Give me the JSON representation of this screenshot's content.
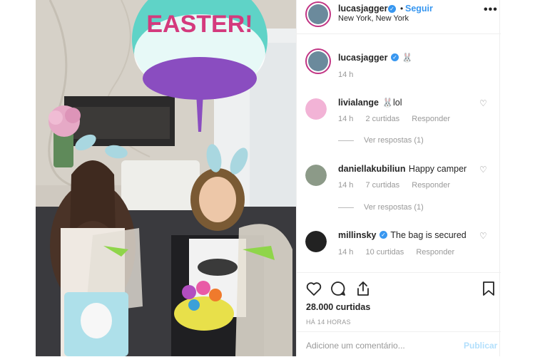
{
  "post": {
    "username": "lucasjagger",
    "follow_label": "Seguir",
    "separator": "•",
    "location": "New York, New York",
    "more_label": "•••",
    "balloon_text": "EASTER!"
  },
  "caption": {
    "username": "lucasjagger",
    "text": "🐰",
    "time": "14 h"
  },
  "comments": [
    {
      "username": "livialange",
      "text": "🐰lol",
      "time": "14 h",
      "likes": "2 curtidas",
      "reply_label": "Responder",
      "view_replies": "Ver respostas (1)"
    },
    {
      "username": "daniellakubiliun",
      "text": "Happy camper",
      "time": "14 h",
      "likes": "7 curtidas",
      "reply_label": "Responder",
      "view_replies": "Ver respostas (1)"
    },
    {
      "username": "millinsky",
      "text": "The bag is secured",
      "time": "14 h",
      "likes": "10 curtidas",
      "reply_label": "Responder"
    }
  ],
  "stats": {
    "likes": "28.000 curtidas",
    "time_ago": "HÁ 14 HORAS"
  },
  "composer": {
    "placeholder": "Adicione um comentário...",
    "publish_label": "Publicar"
  },
  "colors": {
    "link": "#3897f0",
    "muted": "#999999",
    "text": "#262626"
  },
  "icons": [
    "heart-icon",
    "comment-icon",
    "share-icon",
    "bookmark-icon",
    "verified-icon",
    "more-icon"
  ]
}
